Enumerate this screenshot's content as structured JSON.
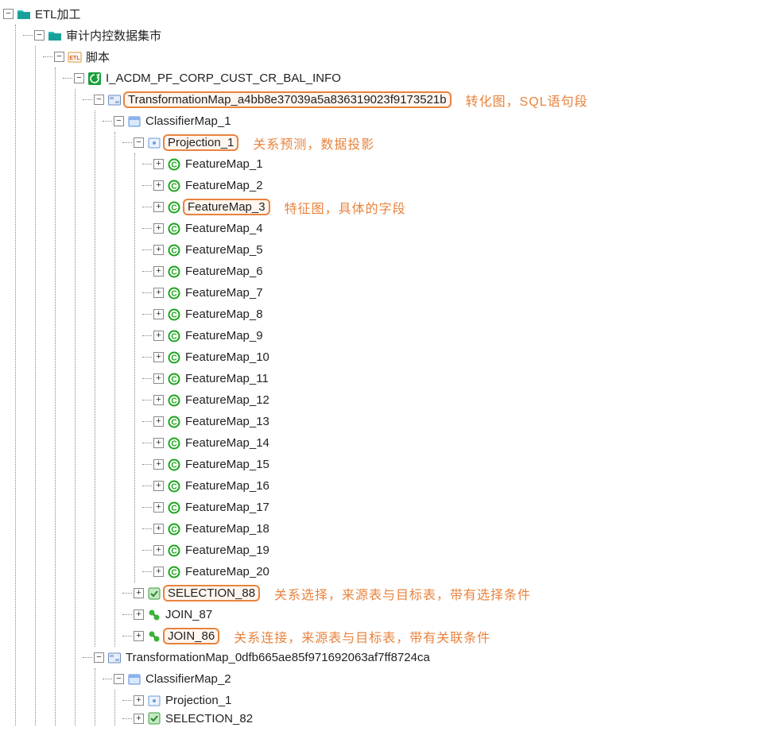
{
  "root": {
    "label": "ETL加工",
    "child": {
      "label": "审计内控数据集市",
      "child": {
        "label": "脚本",
        "child": {
          "label": "I_ACDM_PF_CORP_CUST_CR_BAL_INFO",
          "maps": [
            {
              "label": "TransformationMap_a4bb8e37039a5a836319023f9173521b",
              "annotation": "转化图，SQL语句段",
              "classifier": {
                "label": "ClassifierMap_1",
                "projection": {
                  "label": "Projection_1",
                  "annotation": "关系预测，数据投影",
                  "features": [
                    {
                      "label": "FeatureMap_1"
                    },
                    {
                      "label": "FeatureMap_2"
                    },
                    {
                      "label": "FeatureMap_3",
                      "highlight": true,
                      "annotation": "特征图，具体的字段"
                    },
                    {
                      "label": "FeatureMap_4"
                    },
                    {
                      "label": "FeatureMap_5"
                    },
                    {
                      "label": "FeatureMap_6"
                    },
                    {
                      "label": "FeatureMap_7"
                    },
                    {
                      "label": "FeatureMap_8"
                    },
                    {
                      "label": "FeatureMap_9"
                    },
                    {
                      "label": "FeatureMap_10"
                    },
                    {
                      "label": "FeatureMap_11"
                    },
                    {
                      "label": "FeatureMap_12"
                    },
                    {
                      "label": "FeatureMap_13"
                    },
                    {
                      "label": "FeatureMap_14"
                    },
                    {
                      "label": "FeatureMap_15"
                    },
                    {
                      "label": "FeatureMap_16"
                    },
                    {
                      "label": "FeatureMap_17"
                    },
                    {
                      "label": "FeatureMap_18"
                    },
                    {
                      "label": "FeatureMap_19"
                    },
                    {
                      "label": "FeatureMap_20"
                    }
                  ]
                },
                "selection": {
                  "label": "SELECTION_88",
                  "annotation": "关系选择，来源表与目标表，带有选择条件"
                },
                "joins": [
                  {
                    "label": "JOIN_87"
                  },
                  {
                    "label": "JOIN_86",
                    "highlight": true,
                    "annotation": "关系连接，来源表与目标表，带有关联条件"
                  }
                ]
              }
            },
            {
              "label": "TransformationMap_0dfb665ae85f971692063af7ff8724ca",
              "classifier": {
                "label": "ClassifierMap_2",
                "projection": {
                  "label": "Projection_1"
                },
                "selection_cut": {
                  "label": "SELECTION_82"
                }
              }
            }
          ]
        }
      }
    }
  }
}
